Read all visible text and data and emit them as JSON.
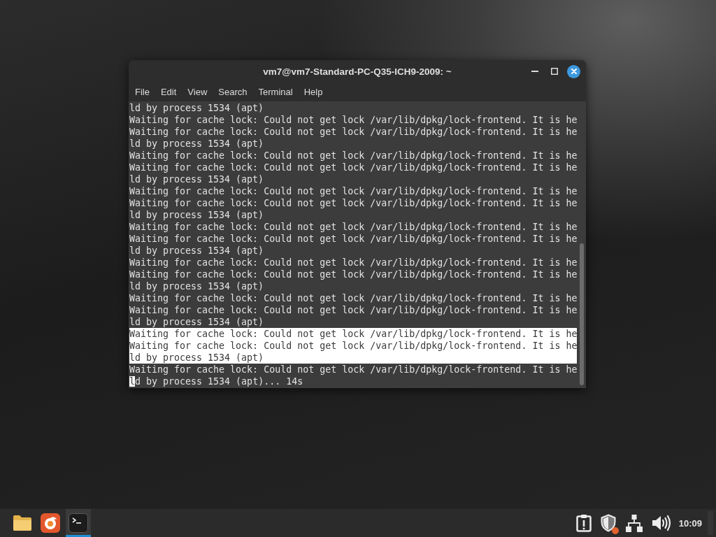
{
  "window": {
    "title": "vm7@vm7-Standard-PC-Q35-ICH9-2009: ~"
  },
  "menu": [
    "File",
    "Edit",
    "View",
    "Search",
    "Terminal",
    "Help"
  ],
  "terminal": {
    "lines": [
      {
        "text": "ld by process 1534 (apt)",
        "selected": false,
        "cursor": false
      },
      {
        "text": "Waiting for cache lock: Could not get lock /var/lib/dpkg/lock-frontend. It is he",
        "selected": false,
        "cursor": false
      },
      {
        "text": "Waiting for cache lock: Could not get lock /var/lib/dpkg/lock-frontend. It is he",
        "selected": false,
        "cursor": false
      },
      {
        "text": "ld by process 1534 (apt)",
        "selected": false,
        "cursor": false
      },
      {
        "text": "Waiting for cache lock: Could not get lock /var/lib/dpkg/lock-frontend. It is he",
        "selected": false,
        "cursor": false
      },
      {
        "text": "Waiting for cache lock: Could not get lock /var/lib/dpkg/lock-frontend. It is he",
        "selected": false,
        "cursor": false
      },
      {
        "text": "ld by process 1534 (apt)",
        "selected": false,
        "cursor": false
      },
      {
        "text": "Waiting for cache lock: Could not get lock /var/lib/dpkg/lock-frontend. It is he",
        "selected": false,
        "cursor": false
      },
      {
        "text": "Waiting for cache lock: Could not get lock /var/lib/dpkg/lock-frontend. It is he",
        "selected": false,
        "cursor": false
      },
      {
        "text": "ld by process 1534 (apt)",
        "selected": false,
        "cursor": false
      },
      {
        "text": "Waiting for cache lock: Could not get lock /var/lib/dpkg/lock-frontend. It is he",
        "selected": false,
        "cursor": false
      },
      {
        "text": "Waiting for cache lock: Could not get lock /var/lib/dpkg/lock-frontend. It is he",
        "selected": false,
        "cursor": false
      },
      {
        "text": "ld by process 1534 (apt)",
        "selected": false,
        "cursor": false
      },
      {
        "text": "Waiting for cache lock: Could not get lock /var/lib/dpkg/lock-frontend. It is he",
        "selected": false,
        "cursor": false
      },
      {
        "text": "Waiting for cache lock: Could not get lock /var/lib/dpkg/lock-frontend. It is he",
        "selected": false,
        "cursor": false
      },
      {
        "text": "ld by process 1534 (apt)",
        "selected": false,
        "cursor": false
      },
      {
        "text": "Waiting for cache lock: Could not get lock /var/lib/dpkg/lock-frontend. It is he",
        "selected": false,
        "cursor": false
      },
      {
        "text": "Waiting for cache lock: Could not get lock /var/lib/dpkg/lock-frontend. It is he",
        "selected": false,
        "cursor": false
      },
      {
        "text": "ld by process 1534 (apt)",
        "selected": false,
        "cursor": false
      },
      {
        "text": "Waiting for cache lock: Could not get lock /var/lib/dpkg/lock-frontend. It is he",
        "selected": true,
        "cursor": false
      },
      {
        "text": "Waiting for cache lock: Could not get lock /var/lib/dpkg/lock-frontend. It is he",
        "selected": true,
        "cursor": false
      },
      {
        "text": "ld by process 1534 (apt)",
        "selected": true,
        "cursor": false
      },
      {
        "text": "Waiting for cache lock: Could not get lock /var/lib/dpkg/lock-frontend. It is he",
        "selected": false,
        "cursor": false
      },
      {
        "text": "ld by process 1534 (apt)... 14s",
        "selected": false,
        "cursor": true
      }
    ]
  },
  "taskbar": {
    "launchers": [
      {
        "kind": "folder",
        "active": false
      },
      {
        "kind": "browser",
        "active": false
      },
      {
        "kind": "terminal",
        "active": true
      }
    ],
    "tray": [
      {
        "kind": "clipboard",
        "badge": false
      },
      {
        "kind": "shield",
        "badge": true
      },
      {
        "kind": "network",
        "badge": false
      },
      {
        "kind": "volume",
        "badge": false
      }
    ],
    "clock": "10:09"
  }
}
